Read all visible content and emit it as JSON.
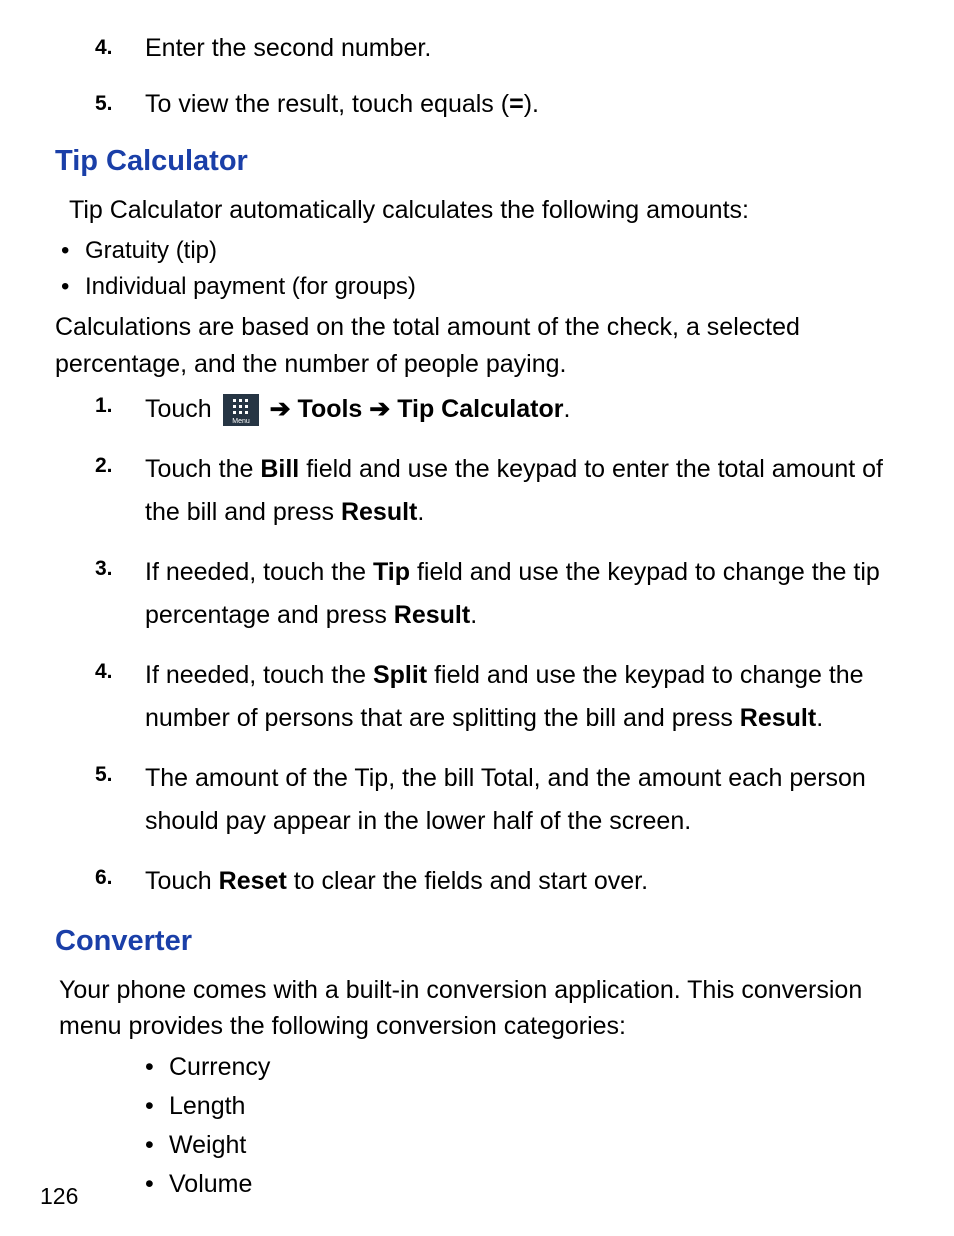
{
  "top_steps": [
    {
      "num": "4.",
      "text": "Enter the second number."
    },
    {
      "num": "5.",
      "prefix": "To view the result, touch equals (",
      "bold": "=",
      "suffix": ")."
    }
  ],
  "tipcalc": {
    "heading": "Tip Calculator",
    "intro": "Tip Calculator automatically calculates the following amounts:",
    "bullets": [
      "Gratuity (tip)",
      "Individual payment (for groups)"
    ],
    "para": "Calculations are based on the total amount of the check, a selected percentage, and the number of people paying.",
    "steps": [
      {
        "num": "1.",
        "prefix": "Touch  ",
        "menu_label": "Menu",
        "arrow1": "➔",
        "bold1": "Tools",
        "arrow2": "➔",
        "bold2": "Tip Calculator",
        "suffix": "."
      },
      {
        "num": "2.",
        "prefix": "Touch the ",
        "bold1": "Bill",
        "mid": " field and use the keypad to enter the total amount of the bill and press ",
        "bold2": "Result",
        "suffix": "."
      },
      {
        "num": "3.",
        "prefix": "If needed, touch the ",
        "bold1": "Tip",
        "mid": " field and use the keypad to change the tip percentage and press ",
        "bold2": "Result",
        "suffix": "."
      },
      {
        "num": "4.",
        "prefix": "If needed, touch the ",
        "bold1": "Split",
        "mid": " field and use the keypad to change the number of persons that are splitting the bill and press ",
        "bold2": "Result",
        "suffix": "."
      },
      {
        "num": "5.",
        "text": "The amount of the Tip, the bill Total, and the amount each person should pay appear in the lower half of the screen."
      },
      {
        "num": "6.",
        "prefix": "Touch ",
        "bold1": "Reset",
        "mid": " to clear the fields and start over.",
        "suffix": ""
      }
    ]
  },
  "converter": {
    "heading": "Converter",
    "para": "Your phone comes with a built-in conversion application. This conversion menu provides the following conversion categories:",
    "bullets": [
      "Currency",
      "Length",
      "Weight",
      "Volume"
    ]
  },
  "page_number": "126"
}
